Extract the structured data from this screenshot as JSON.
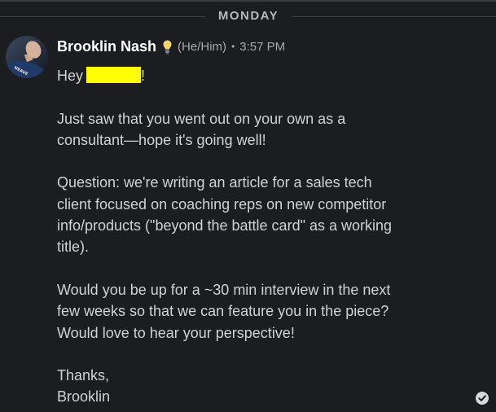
{
  "day_divider": {
    "label": "MONDAY"
  },
  "message": {
    "sender": "Brooklin Nash",
    "status_icon": "lightbulb-icon",
    "pronouns": "(He/Him)",
    "separator": "•",
    "timestamp": "3:57 PM",
    "greeting_prefix": "Hey",
    "greeting_suffix": "!",
    "paragraphs": [
      [
        "Just saw that you went out on your own as a",
        "consultant—hope it's going well!"
      ],
      [
        "Question: we're writing an article for a sales tech",
        "client focused on coaching reps on new competitor",
        "info/products (\"beyond the battle card\" as a working",
        "title)."
      ],
      [
        "Would you be up for a ~30 min interview in the next",
        "few weeks so that we can feature you in the piece?",
        "Would love to hear your perspective!"
      ],
      [
        "Thanks,",
        "Brooklin"
      ]
    ]
  },
  "avatar": {
    "shirt_text": "NEAVE"
  },
  "read_receipt_icon": "checkmark-circle-icon",
  "colors": {
    "background": "#1b1d21",
    "text": "#d1d2d3",
    "sender": "#ffffff",
    "muted": "#a8a9ab",
    "redaction": "#ffff00"
  }
}
